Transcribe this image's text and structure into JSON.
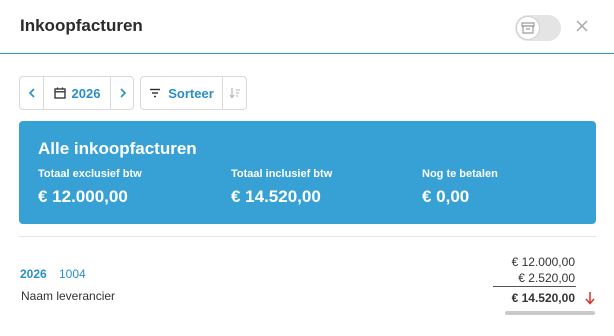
{
  "window": {
    "title": "Inkoopfacturen"
  },
  "toolbar": {
    "year": "2026",
    "sort_label": "Sorteer"
  },
  "summary": {
    "title": "Alle inkoopfacturen",
    "excl_label": "Totaal exclusief btw",
    "excl_value": "€ 12.000,00",
    "incl_label": "Totaal inclusief btw",
    "incl_value": "€ 14.520,00",
    "due_label": "Nog te betalen",
    "due_value": "€ 0,00"
  },
  "invoices": [
    {
      "year": "2026",
      "number": "1004",
      "supplier": "Naam leverancier",
      "amount_excl": "€ 12.000,00",
      "vat": "€ 2.520,00",
      "amount_incl": "€ 14.520,00"
    }
  ],
  "colors": {
    "accent": "#2a8fc7",
    "summary_bg": "#37a0d4",
    "alert": "#d9302c"
  },
  "icons": [
    "archive-icon",
    "close-icon",
    "chevron-left-icon",
    "calendar-icon",
    "chevron-right-icon",
    "filter-icon",
    "sort-direction-icon",
    "arrow-down-icon"
  ]
}
